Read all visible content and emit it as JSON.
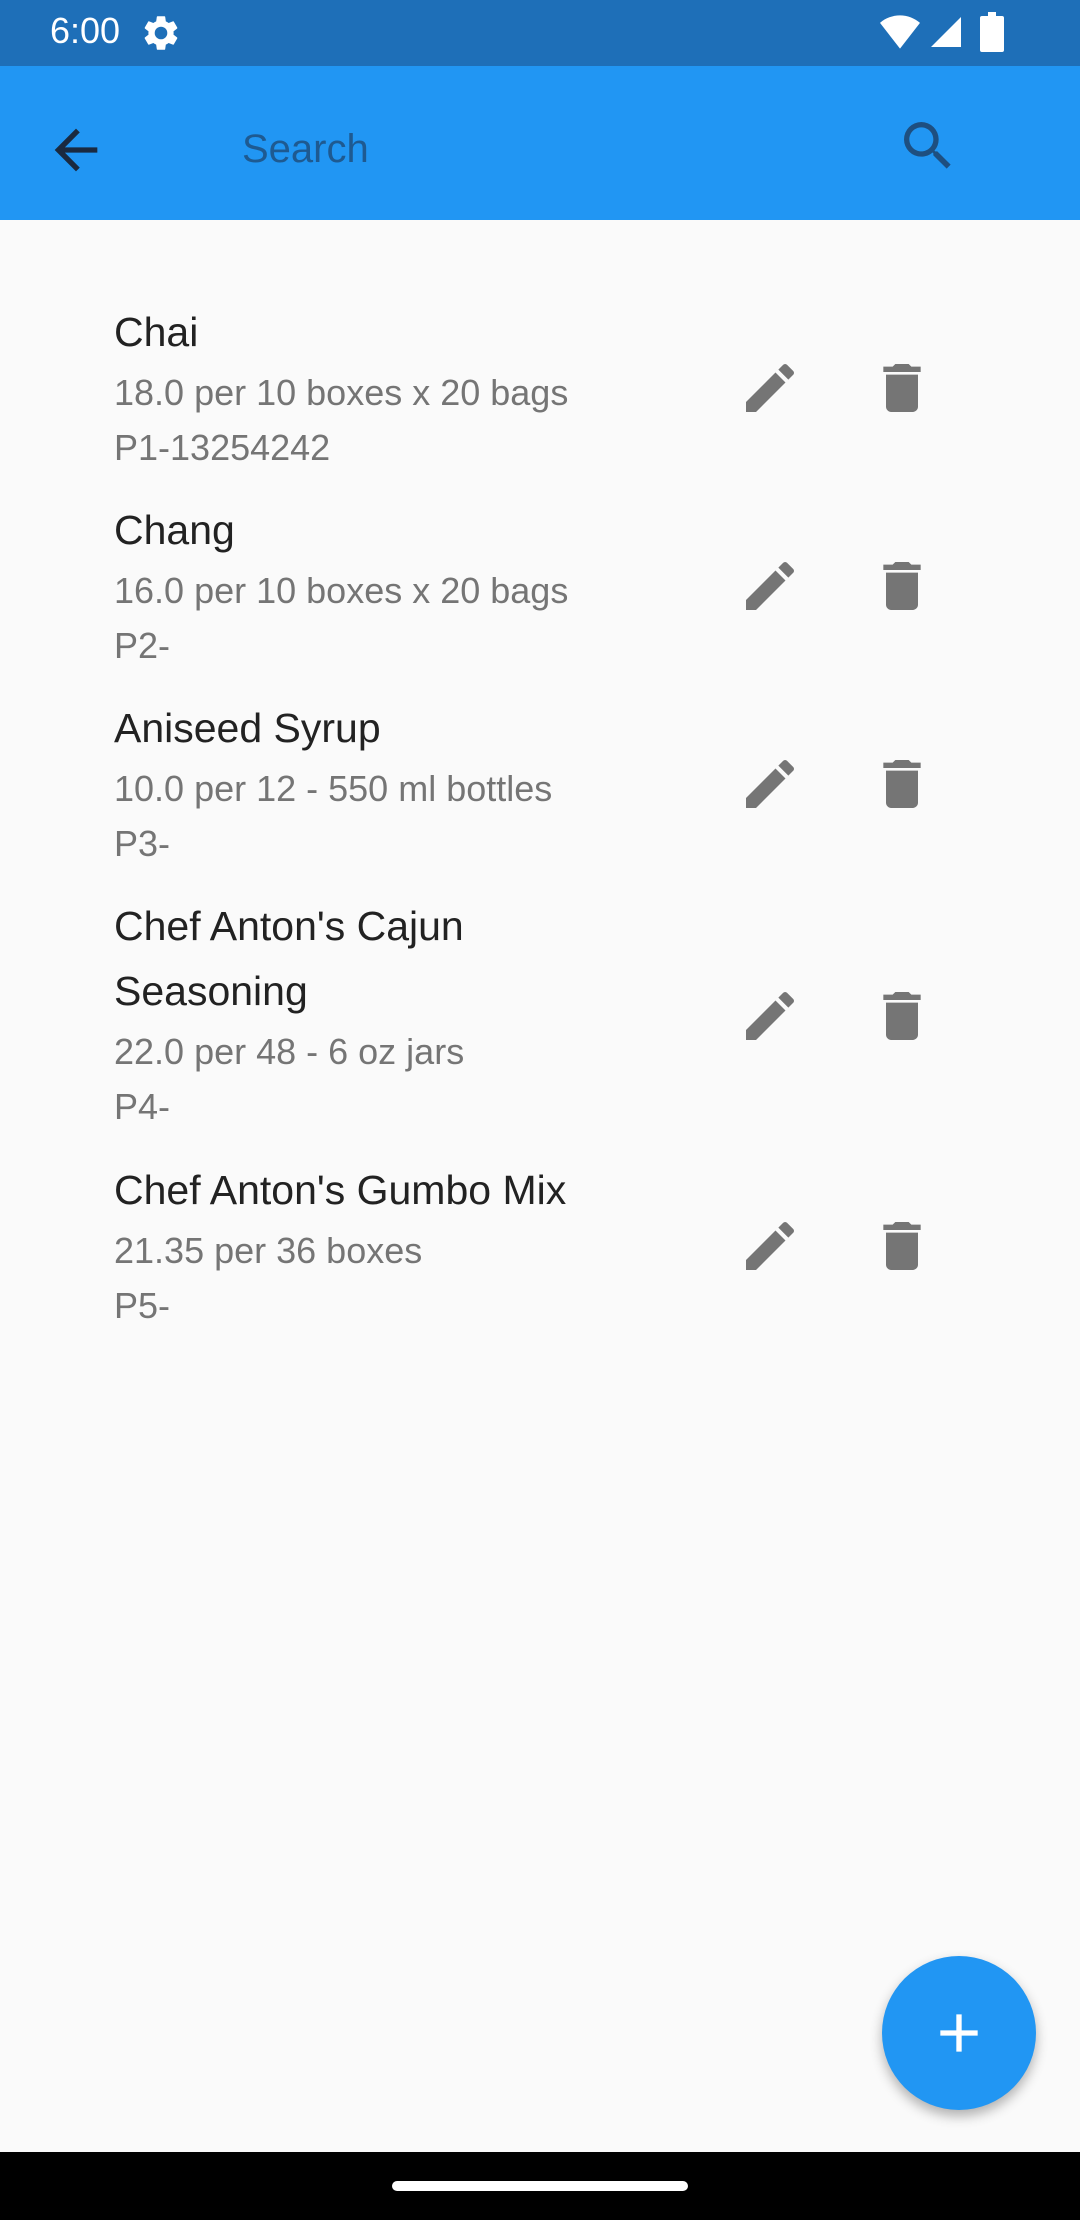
{
  "status_bar": {
    "time": "6:00",
    "icons": [
      "gear-icon",
      "wifi-icon",
      "signal-icon",
      "battery-icon"
    ]
  },
  "app_bar": {
    "search_placeholder": "Search",
    "icons": [
      "back-arrow-icon",
      "search-icon"
    ]
  },
  "products": [
    {
      "name": "Chai",
      "detail": "18.0 per 10 boxes x 20 bags",
      "code": "P1-13254242"
    },
    {
      "name": "Chang",
      "detail": "16.0 per 10 boxes x 20 bags",
      "code": "P2-"
    },
    {
      "name": "Aniseed Syrup",
      "detail": "10.0 per 12 - 550 ml bottles",
      "code": "P3-"
    },
    {
      "name": "Chef Anton's Cajun Seasoning",
      "detail": "22.0 per 48 - 6 oz jars",
      "code": "P4-"
    },
    {
      "name": "Chef Anton's Gumbo Mix",
      "detail": "21.35 per 36 boxes",
      "code": "P5-"
    }
  ],
  "row_icons": [
    "edit-icon",
    "delete-icon"
  ],
  "fab_icon": "add-icon",
  "colors": {
    "status_bar": "#1e6fb8",
    "app_bar": "#2196f3",
    "fab": "#2196f3",
    "icon_gray": "#757575",
    "background": "#fafafa"
  }
}
